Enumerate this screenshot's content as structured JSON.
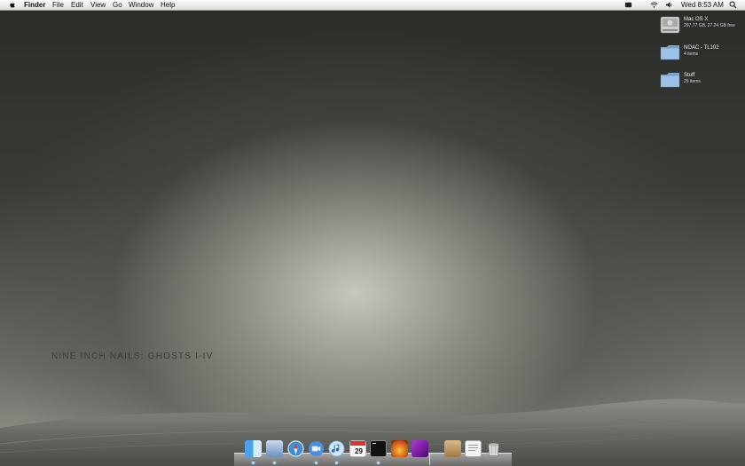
{
  "menubar": {
    "app_name": "Finder",
    "menus": [
      "File",
      "Edit",
      "View",
      "Go",
      "Window",
      "Help"
    ],
    "clock": "Wed 8:53 AM",
    "status_icons": [
      "time-machine-icon",
      "wifi-icon",
      "volume-icon",
      "spotlight-icon"
    ]
  },
  "desktop_icons": [
    {
      "name": "Mac OS X",
      "subtitle": "297.77 GB, 27.24 GB free",
      "icon": "hard-drive-icon"
    },
    {
      "name": "NOAC - TL102",
      "subtitle": "4 items",
      "icon": "folder-icon"
    },
    {
      "name": "Stuff",
      "subtitle": "29 items",
      "icon": "folder-icon"
    }
  ],
  "wallpaper": {
    "text": "NINE INCH NAILS: GHOSTS I-IV"
  },
  "dock": {
    "items": [
      "finder",
      "preview",
      "safari",
      "ichat",
      "itunes",
      "ical",
      "terminal",
      "photo-booth",
      "app",
      "documents-stack",
      "text-file",
      "trash"
    ],
    "calendar_date": "29"
  },
  "colors": {
    "menubar": "#ececec",
    "desktop_icon_label": "#f2f2f2",
    "folder": "#8fb8dd"
  }
}
